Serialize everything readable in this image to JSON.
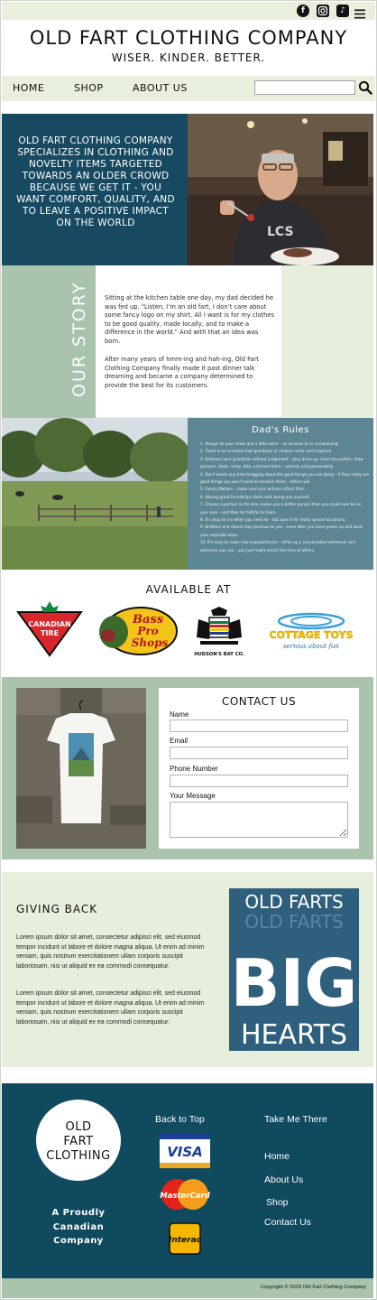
{
  "colors": {
    "dark_teal": "#174a60",
    "footer_teal": "#0f4a5e",
    "sage": "#a9c3ad",
    "light_green": "#e6efdc",
    "slate_blue": "#5e8593"
  },
  "social": {
    "icons": [
      "facebook-icon",
      "instagram-icon",
      "tiktok-icon",
      "hamburger-menu-icon"
    ]
  },
  "header": {
    "title": "OLD FART CLOTHING COMPANY",
    "tagline": "WISER. KINDER. BETTER."
  },
  "nav": {
    "items": [
      {
        "label": "HOME"
      },
      {
        "label": "SHOP"
      },
      {
        "label": "ABOUT US"
      }
    ],
    "search_placeholder": "",
    "search_icon": "search-icon"
  },
  "hero": {
    "text": "OLD FART CLOTHING COMPANY SPECIALIZES IN CLOTHING AND NOVELTY ITEMS TARGETED TOWARDS AN OLDER CROWD BECAUSE WE GET IT - YOU WANT COMFORT, QUALITY, AND TO LEAVE A POSITIVE IMPACT ON THE WORLD"
  },
  "story": {
    "heading": "OUR STORY",
    "paragraphs": [
      "Sitting at the kitchen table one day, my dad decided he was fed up.  “Listen, I’m an old fart, I don’t care about some fancy logo on my shirt.  All I want is for my clothes to be good quality, made locally, and to make a difference in the world.”  And with that an idea was born.",
      "After many years of hmm-ing and hah-ing, Old Fart Clothing Company finally made it past dinner talk dreaming and became a company determined to provide the best for its customers."
    ]
  },
  "rules": {
    "title": "Dad's Rules",
    "items": [
      "1. Always do your share and a little extra – no excuses & no complaining.",
      "2. There is no occasion that gumdrops or cheese curds can't improve.",
      "3. Embrace your grandkids without judgement – play dress-up, have tea parties, draw pictures, skate, camp, bike, and love them – actively and passionately.",
      "4. Don't waste any time bragging about the good things you are doing – if they really are good things you won't need to mention them – others will.",
      "5. Family Matters – make sure your actions reflect that.",
      "6. Having great friendships starts with being one yourself.",
      "7. Choose a partner in life who makes you a better person than you could ever be on your own – and then be faithful to them.",
      "8. It's okay to cry when you need to – but save it for really special occasions.",
      "9. Brothers and sisters stay precious to you – even after you have grown up and went your separate ways.",
      "10. It's easy to make new acquaintances – strike up a conversation whenever and wherever you can – you just might enrich the lives of others."
    ]
  },
  "available": {
    "title": "AVAILABLE AT",
    "brands": [
      {
        "line1": "CANADIAN",
        "line2": "TIRE"
      },
      {
        "line1": "Bass",
        "line2": "Pro",
        "line3": "Shops"
      },
      {
        "caption": "HUDSON'S BAY CO."
      },
      {
        "line1": "COTTAGE TOYS",
        "line2": "serious about fun"
      }
    ]
  },
  "contact": {
    "title": "CONTACT US",
    "fields": [
      {
        "label": "Name",
        "value": ""
      },
      {
        "label": "Email",
        "value": ""
      },
      {
        "label": "Phone Number",
        "value": ""
      },
      {
        "label": "Your Message",
        "value": ""
      }
    ]
  },
  "giving": {
    "title": "GIVING BACK",
    "paragraphs": [
      "Lorem ipsum dolor sit amet, consectetur adipisci elit, sed eiusmod tempor incidunt ut labore et dolore magna aliqua. Ut enim ad minim veniam, quis nostrum exercitationem ullam corporis suscipit laboriosam, nisi ut aliquid ex ea commodi consequatur.",
      "Lorem ipsum dolor sit amet, consectetur adipisci elit, sed eiusmod tempor incidunt ut labore et dolore magna aliqua. Ut enim ad minim veniam, quis nostrum exercitationem ullam corporis suscipit laboriosam, nisi ut aliquid ex ea commodi consequatur."
    ],
    "poster": {
      "top": "OLD FARTS",
      "big": "BIG",
      "bottom": "HEARTS",
      "echo": "OLD FARTS"
    }
  },
  "footer": {
    "logo_lines": [
      "OLD",
      "FART",
      "CLOTHING"
    ],
    "proud_lines": [
      "A Proudly",
      "Canadian",
      "Company"
    ],
    "back_to_top": "Back to Top",
    "take_me_there": "Take Me There",
    "links": [
      {
        "label": "Home"
      },
      {
        "label": "About Us"
      },
      {
        "label": "Shop"
      },
      {
        "label": "Contact Us"
      }
    ],
    "payments": [
      {
        "label": "VISA"
      },
      {
        "label": "MasterCard"
      },
      {
        "label": "Interac"
      }
    ],
    "copyright": "Copyright © 2023 Old Fart Clothing Company"
  }
}
